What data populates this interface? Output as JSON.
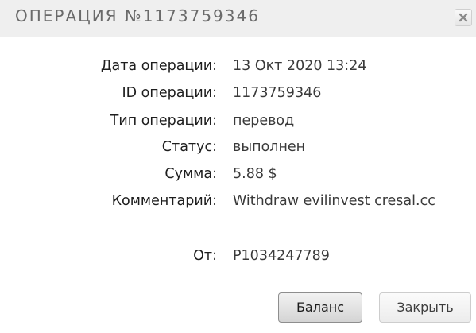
{
  "dialog": {
    "title": "ОПЕРАЦИЯ №1173759346",
    "close_icon": "close-icon"
  },
  "details": [
    {
      "label": "Дата операции:",
      "value": "13 Окт 2020 13:24"
    },
    {
      "label": "ID операции:",
      "value": "1173759346"
    },
    {
      "label": "Тип операции:",
      "value": "перевод"
    },
    {
      "label": "Статус:",
      "value": "выполнен"
    },
    {
      "label": "Сумма:",
      "value": "5.88 $"
    },
    {
      "label": "Комментарий:",
      "value": "Withdraw evilinvest cresal.cc"
    }
  ],
  "sender": {
    "label": "От:",
    "value": "P1034247789"
  },
  "buttons": {
    "balance_label": "Баланс",
    "close_label": "Закрыть"
  },
  "colors": {
    "titlebar_bg": "#efefef",
    "title_text": "#6a6a6a"
  }
}
